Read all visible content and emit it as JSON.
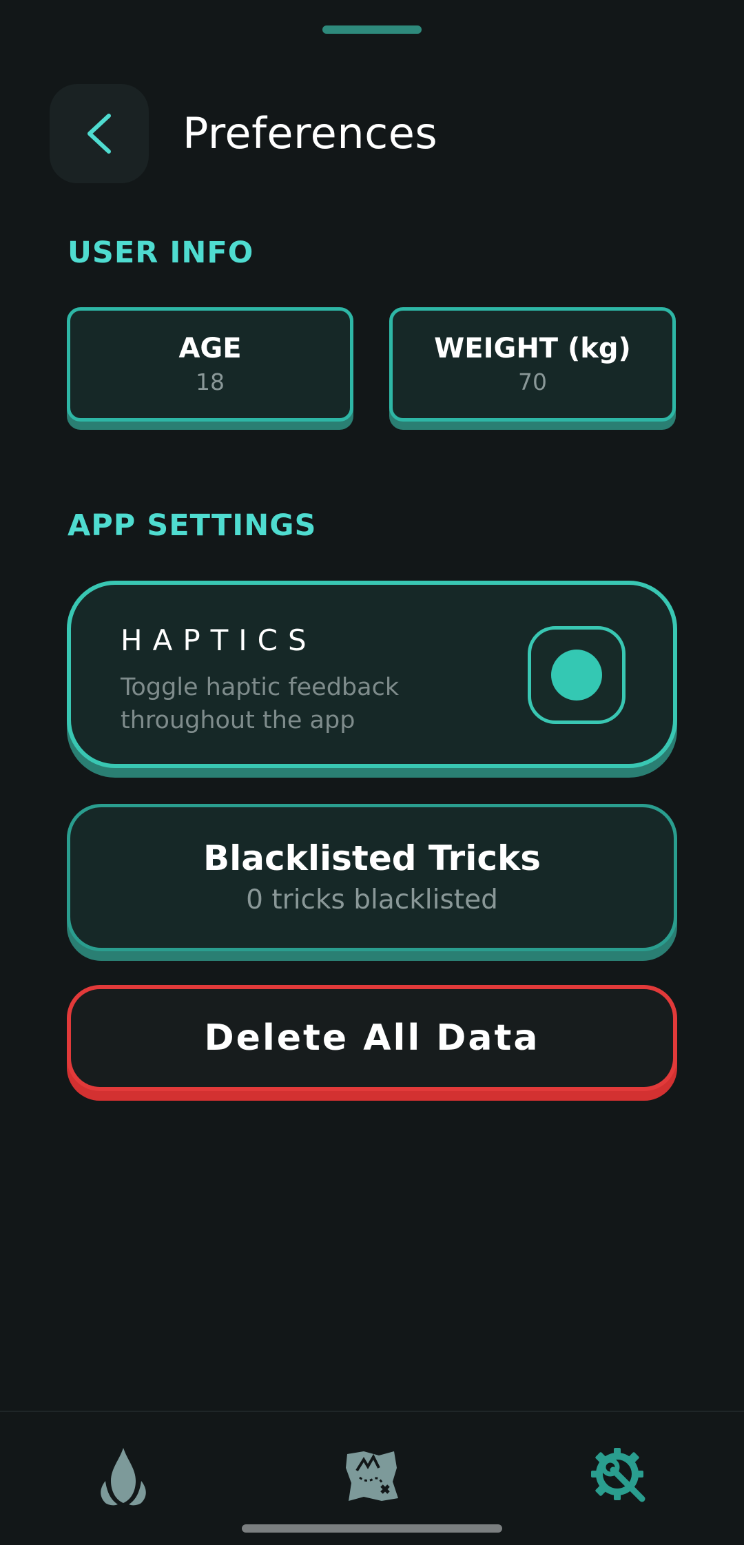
{
  "header": {
    "title": "Preferences",
    "back_icon": "chevron-left-icon"
  },
  "user_info": {
    "section_title": "USER INFO",
    "age_label": "AGE",
    "age_value": "18",
    "weight_label": "WEIGHT (kg)",
    "weight_value": "70"
  },
  "app_settings": {
    "section_title": "APP SETTINGS",
    "haptics": {
      "title": "HAPTICS",
      "description": "Toggle haptic feedback throughout the app",
      "enabled": true
    },
    "blacklist": {
      "title": "Blacklisted Tricks",
      "subtitle": "0 tricks blacklisted"
    },
    "delete": {
      "label": "Delete All Data"
    }
  },
  "bottom_nav": {
    "items": [
      {
        "icon": "flame-icon",
        "active": false
      },
      {
        "icon": "treasure-map-icon",
        "active": false
      },
      {
        "icon": "gear-wrench-icon",
        "active": true
      }
    ]
  },
  "colors": {
    "background": "#121718",
    "accent": "#4fdcd0",
    "card_border": "#39c7b3",
    "danger": "#e23a3a"
  }
}
